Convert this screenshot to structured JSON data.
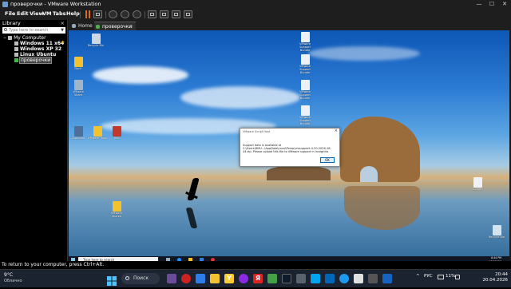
{
  "window": {
    "title": "проверочки - VMware Workstation",
    "minimize": "—",
    "maximize": "☐",
    "close": "✕"
  },
  "menu": [
    "File",
    "Edit",
    "View",
    "VM",
    "Tabs",
    "Help"
  ],
  "library": {
    "title": "Library",
    "close": "×",
    "search_placeholder": "Type here to search",
    "tree": {
      "root": "My Computer",
      "items": [
        "Windows 11 x64",
        "Windows XP 32",
        "Linux Ubuntu",
        "проверочки"
      ],
      "favorite_item": "Windows 11 x64",
      "selected_item": "проверочки"
    }
  },
  "tabs": [
    {
      "label": "Home",
      "active": false
    },
    {
      "label": "проверочки",
      "active": true,
      "close": "×"
    }
  ],
  "guest": {
    "desktop_icons": {
      "left": [
        "Recycle Bin",
        "Doclr",
        "VMware Share"
      ],
      "row": [
        "Clipboard",
        "VMware Tools",
        "test"
      ],
      "bottom_left": [
        "VMware Shared"
      ],
      "right": [
        "VMware Support Bundle",
        "VMware Support Bundle",
        "VMware Support Bundle",
        "VMware Support Bundle"
      ],
      "right_small": [
        "Support"
      ],
      "recycle_bin": "Recycle Bin"
    },
    "dialog": {
      "title": "VMware Script Host",
      "message": "Support data is available at C:\\Users\\RMU...\\AppData\\Local\\Temp\\vmsupport-4-20-2026-18-44.zip. Please upload this file to VMware support in incognito.",
      "ok": "OK"
    },
    "taskbar": {
      "search_placeholder": "Type here to search",
      "clock_time": "6:44 PM",
      "clock_date": "4/20/2026"
    }
  },
  "status_bar": "To return to your computer, press Ctrl+Alt.",
  "host_taskbar": {
    "weather_temp": "9°C",
    "weather_condition": "Облачно",
    "search_label": "Поиск",
    "tray_lang": "РУС",
    "tray_percent": "11%",
    "clock_time": "20:44",
    "clock_date": "20.04.2026"
  },
  "colors": {
    "accent_pause": "#e26a16",
    "dialog_ok_border": "#0067c0",
    "desktop_sky": "#2b7bd4"
  }
}
